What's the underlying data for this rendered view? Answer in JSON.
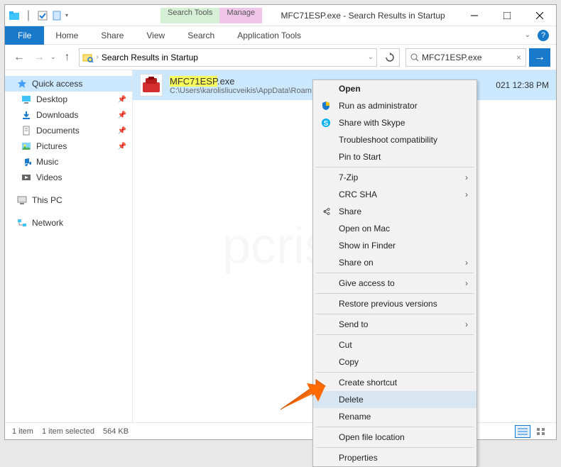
{
  "titlebar": {
    "ctx_search": "Search Tools",
    "ctx_manage": "Manage",
    "title": "MFC71ESP.exe - Search Results in Startup"
  },
  "ribbon": {
    "file": "File",
    "tabs": [
      "Home",
      "Share",
      "View",
      "Search",
      "Application Tools"
    ]
  },
  "nav": {
    "breadcrumb": "Search Results in Startup",
    "search_value": "MFC71ESP.exe"
  },
  "sidebar": {
    "quick_access": "Quick access",
    "items": [
      {
        "label": "Desktop",
        "pinned": true
      },
      {
        "label": "Downloads",
        "pinned": true
      },
      {
        "label": "Documents",
        "pinned": true
      },
      {
        "label": "Pictures",
        "pinned": true
      },
      {
        "label": "Music",
        "pinned": false
      },
      {
        "label": "Videos",
        "pinned": false
      }
    ],
    "this_pc": "This PC",
    "network": "Network"
  },
  "file": {
    "name_hl": "MFC71ESP",
    "name_ext": ".exe",
    "path": "C:\\Users\\karolisliucveikis\\AppData\\Roam",
    "date": "021 12:38 PM"
  },
  "context_menu": {
    "open": "Open",
    "run_admin": "Run as administrator",
    "share_skype": "Share with Skype",
    "troubleshoot": "Troubleshoot compatibility",
    "pin_start": "Pin to Start",
    "seven_zip": "7-Zip",
    "crc_sha": "CRC SHA",
    "share": "Share",
    "open_mac": "Open on Mac",
    "show_finder": "Show in Finder",
    "share_on": "Share on",
    "give_access": "Give access to",
    "restore": "Restore previous versions",
    "send_to": "Send to",
    "cut": "Cut",
    "copy": "Copy",
    "create_shortcut": "Create shortcut",
    "delete": "Delete",
    "rename": "Rename",
    "open_location": "Open file location",
    "properties": "Properties"
  },
  "status": {
    "item_count": "1 item",
    "selected": "1 item selected",
    "size": "564 KB"
  },
  "watermark": "pcrisk.com"
}
